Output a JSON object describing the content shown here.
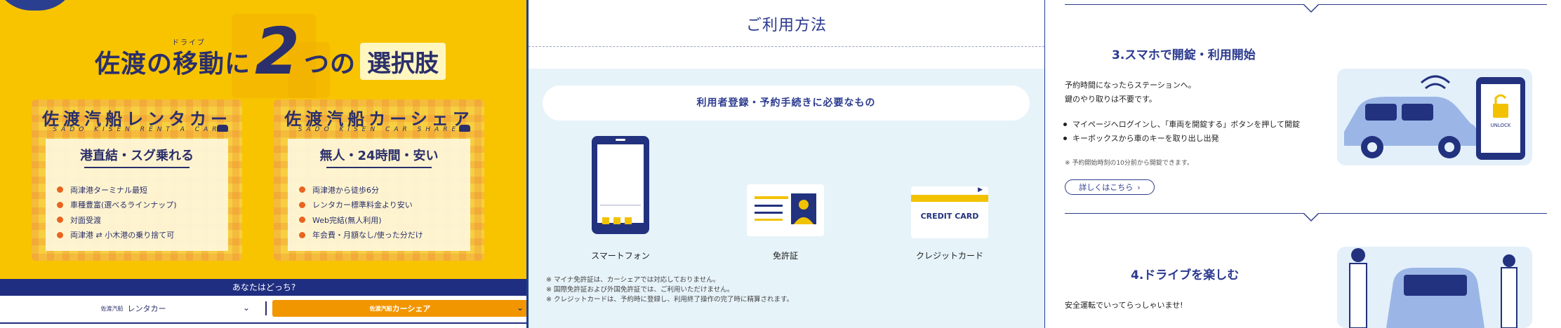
{
  "panel1": {
    "headline": {
      "part1": "佐渡の移動に",
      "ruby": "ドライブ",
      "big": "2",
      "part2": "つの",
      "box": "選択肢"
    },
    "cards": [
      {
        "title": "佐渡汽船レンタカー",
        "subtitle": "SADO KISEN RENT A CAR",
        "tag": "港直結・スグ乗れる",
        "items": [
          "両津港ターミナル最短",
          "車種豊富(選べるラインナップ)",
          "対面受渡",
          "両津港 ⇄ 小木港の乗り捨て可"
        ]
      },
      {
        "title": "佐渡汽船カーシェア",
        "subtitle": "SADO KISEN CAR SHARE",
        "tag": "無人・24時間・安い",
        "items": [
          "両津港から徒歩6分",
          "レンタカー標準料金より安い",
          "Web完結(無人利用)",
          "年会費・月額なし/使った分だけ"
        ]
      }
    ],
    "question": "あなたはどっち?",
    "select_left_brand": "佐渡汽船",
    "select_left": "レンタカー",
    "select_right_brand": "佐渡汽船",
    "select_right": "カーシェア",
    "colors": {
      "bg": "#f8c400",
      "navy": "#1f2e80",
      "orange": "#f29600"
    }
  },
  "panel2": {
    "title": "ご利用方法",
    "pill": "利用者登録・予約手続きに必要なもの",
    "items": [
      {
        "icon": "smartphone-icon",
        "label": "スマートフォン"
      },
      {
        "icon": "license-card-icon",
        "label": "免許証"
      },
      {
        "icon": "credit-card-icon",
        "label": "クレジットカード",
        "card_text": "CREDIT CARD"
      }
    ],
    "notes": [
      "※ マイナ免許証は、カーシェアでは対応しておりません。",
      "※ 国際免許証および外国免許証では、ご利用いただけません。",
      "※ クレジットカードは、予約時に登録し、利用終了操作の完了時に精算されます。"
    ]
  },
  "panel3": {
    "step3_title": "3.スマホで開錠・利用開始",
    "step3_text": [
      "予約時間になったらステーションへ。",
      "鍵のやり取りは不要です。"
    ],
    "step3_bullets": [
      "マイページへログインし、「車両を開錠する」ボタンを押して開錠",
      "キーボックスから車のキーを取り出し出発"
    ],
    "step3_note": "※ 予約開始時刻の10分前から開錠できます。",
    "detail_button": "詳しくはこちら",
    "unlock_text": "UNLOCK",
    "step4_title": "4.ドライブを楽しむ",
    "step4_text": "安全運転でいってらっしゃいませ!"
  }
}
